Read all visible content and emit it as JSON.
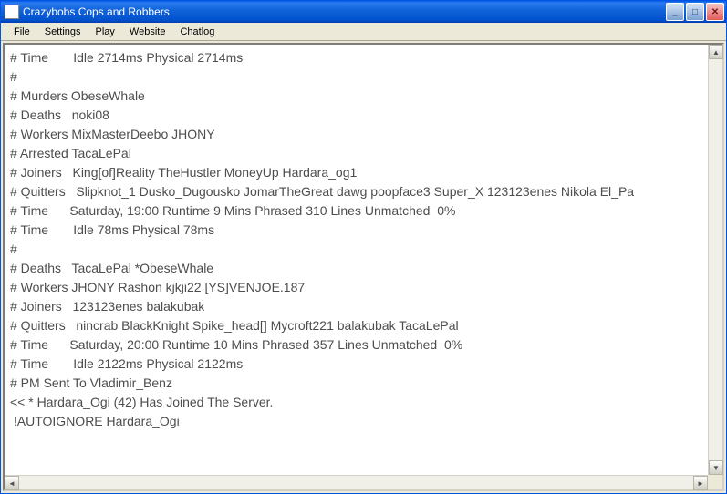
{
  "window": {
    "title": "Crazybobs Cops and Robbers"
  },
  "menu": {
    "items": [
      {
        "label": "File",
        "accel": "F"
      },
      {
        "label": "Settings",
        "accel": "S"
      },
      {
        "label": "Play",
        "accel": "P"
      },
      {
        "label": "Website",
        "accel": "W"
      },
      {
        "label": "Chatlog",
        "accel": "C"
      }
    ]
  },
  "log": {
    "lines": [
      "# Time       Idle 2714ms Physical 2714ms",
      "#",
      "# Murders ObeseWhale",
      "# Deaths   noki08",
      "# Workers MixMasterDeebo JHONY",
      "# Arrested TacaLePal",
      "# Joiners   King[of]Reality TheHustler MoneyUp Hardara_og1",
      "# Quitters   Slipknot_1 Dusko_Dugousko JomarTheGreat dawg poopface3 Super_X 123123enes Nikola El_Pa",
      "# Time      Saturday, 19:00 Runtime 9 Mins Phrased 310 Lines Unmatched  0%",
      "# Time       Idle 78ms Physical 78ms",
      "#",
      "# Deaths   TacaLePal *ObeseWhale",
      "# Workers JHONY Rashon kjkji22 [YS]VENJOE.187",
      "# Joiners   123123enes balakubak",
      "# Quitters   nincrab BlackKnight Spike_head[] Mycroft221 balakubak TacaLePal",
      "# Time      Saturday, 20:00 Runtime 10 Mins Phrased 357 Lines Unmatched  0%",
      "# Time       Idle 2122ms Physical 2122ms",
      "# PM Sent To Vladimir_Benz",
      "<< * Hardara_Ogi (42) Has Joined The Server.",
      " !AUTOIGNORE Hardara_Ogi"
    ]
  }
}
